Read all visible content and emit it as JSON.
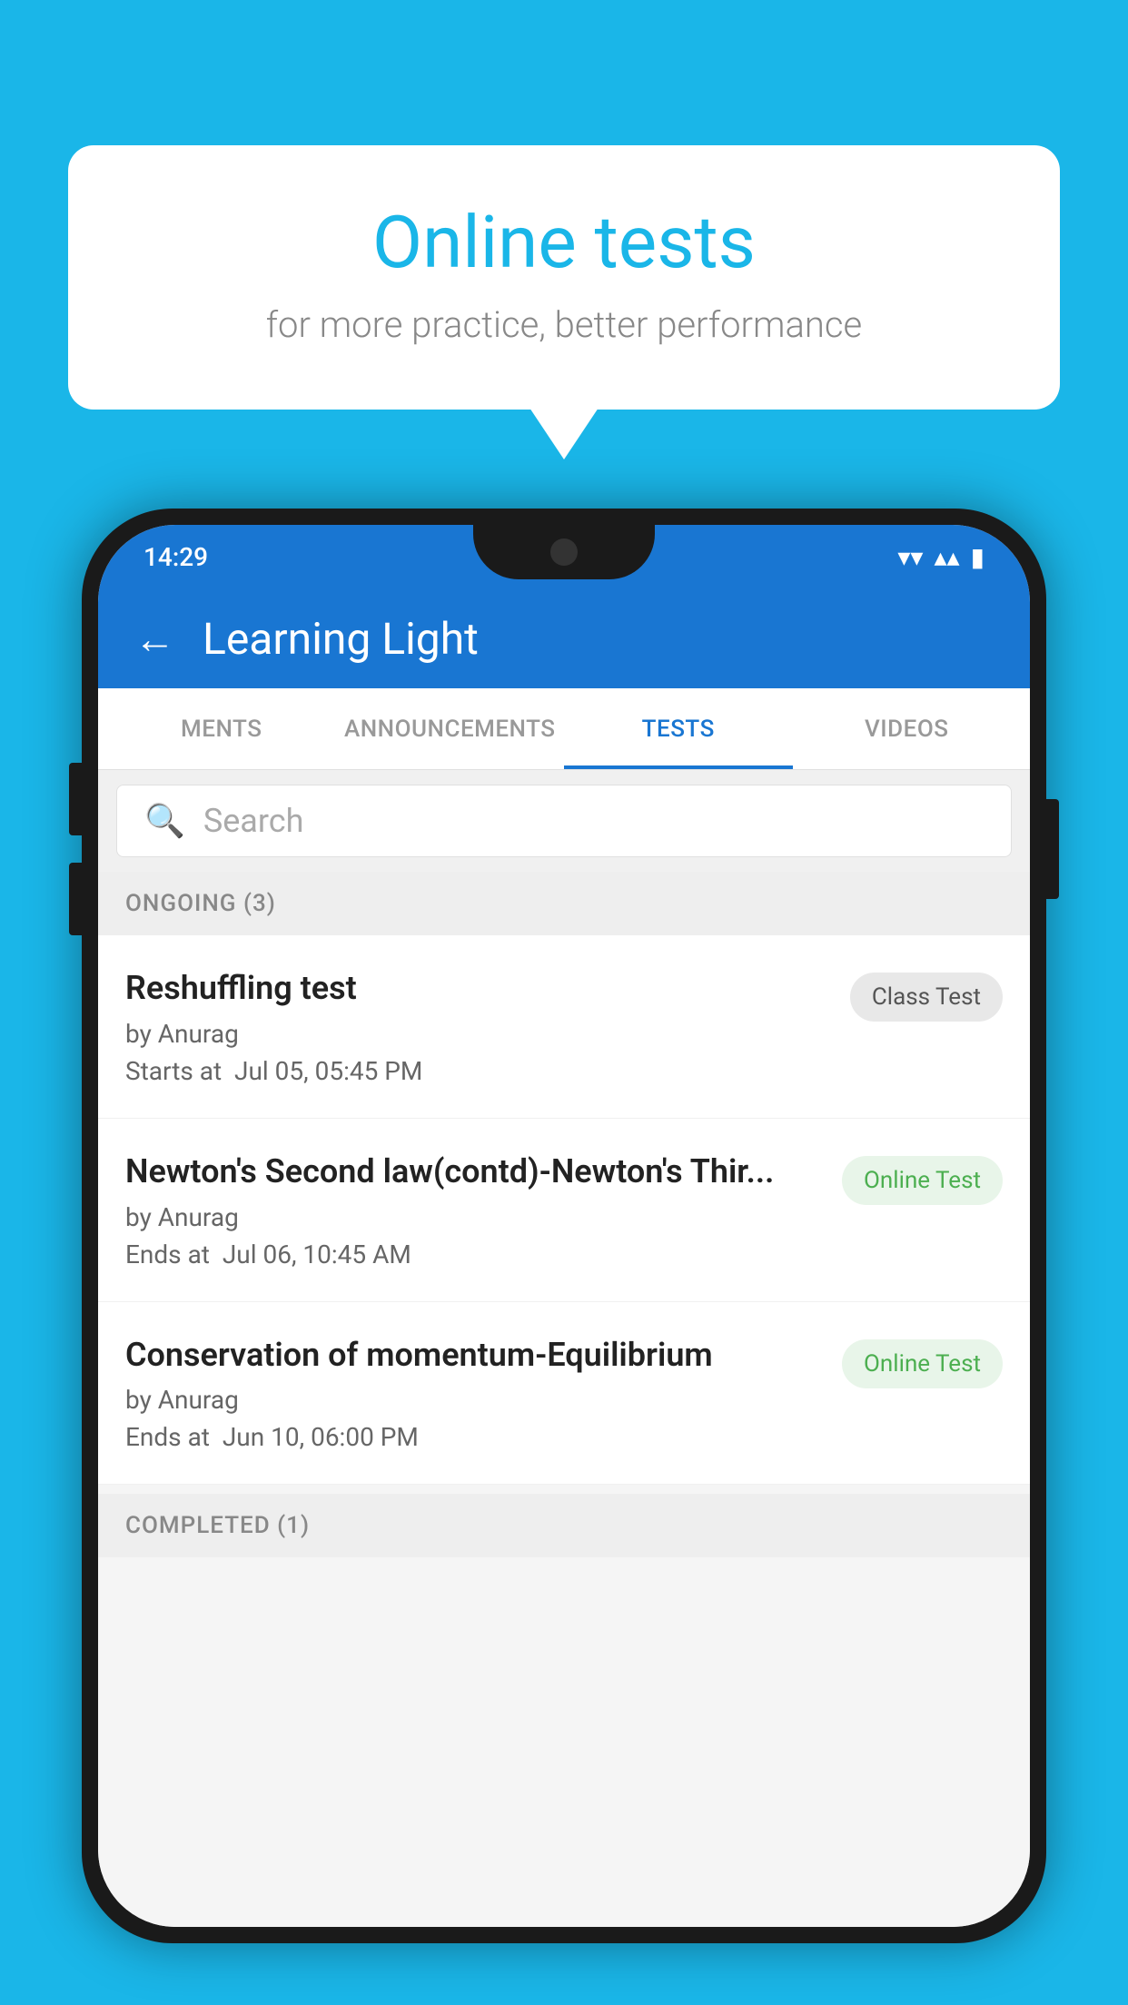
{
  "background_color": "#1ab6e8",
  "speech_bubble": {
    "title": "Online tests",
    "subtitle": "for more practice, better performance"
  },
  "status_bar": {
    "time": "14:29",
    "wifi": "▾",
    "signal": "▴",
    "battery": "▮"
  },
  "app_bar": {
    "back_label": "←",
    "title": "Learning Light"
  },
  "tabs": [
    {
      "label": "MENTS",
      "active": false
    },
    {
      "label": "ANNOUNCEMENTS",
      "active": false
    },
    {
      "label": "TESTS",
      "active": true
    },
    {
      "label": "VIDEOS",
      "active": false
    }
  ],
  "search": {
    "placeholder": "Search"
  },
  "ongoing_section": {
    "header": "ONGOING (3)",
    "tests": [
      {
        "name": "Reshuffling test",
        "author": "by Anurag",
        "time_label": "Starts at",
        "time": "Jul 05, 05:45 PM",
        "badge": "Class Test",
        "badge_type": "class"
      },
      {
        "name": "Newton's Second law(contd)-Newton's Thir...",
        "author": "by Anurag",
        "time_label": "Ends at",
        "time": "Jul 06, 10:45 AM",
        "badge": "Online Test",
        "badge_type": "online"
      },
      {
        "name": "Conservation of momentum-Equilibrium",
        "author": "by Anurag",
        "time_label": "Ends at",
        "time": "Jun 10, 06:00 PM",
        "badge": "Online Test",
        "badge_type": "online"
      }
    ]
  },
  "completed_section": {
    "header": "COMPLETED (1)"
  }
}
